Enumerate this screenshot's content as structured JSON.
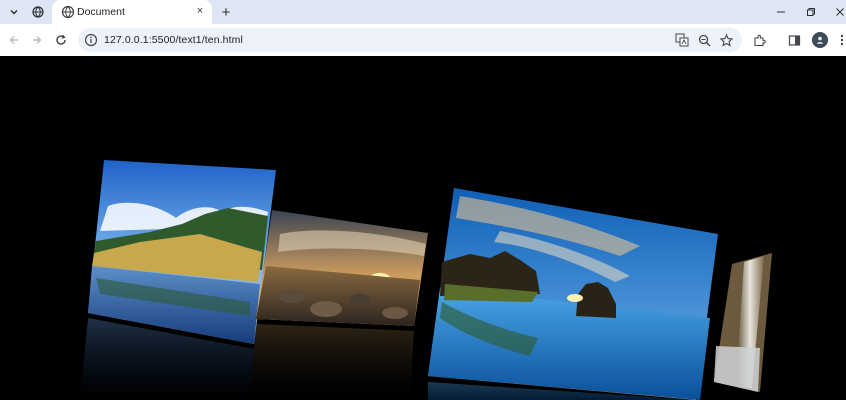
{
  "browser": {
    "tab_title": "Document",
    "url": "127.0.0.1:5500/text1/ten.html",
    "new_tab_label": "+",
    "close_tab_label": "×"
  },
  "gallery": {
    "images": [
      {
        "scene": "lake-forest-mountains"
      },
      {
        "scene": "rocky-shore-sunset"
      },
      {
        "scene": "sea-stacks-sunset-reflection"
      },
      {
        "scene": "waterfall-canyon"
      }
    ]
  },
  "colors": {
    "tab_strip": "#dfe6f3",
    "omnibox": "#edf1f8",
    "page_background": "#000000"
  }
}
